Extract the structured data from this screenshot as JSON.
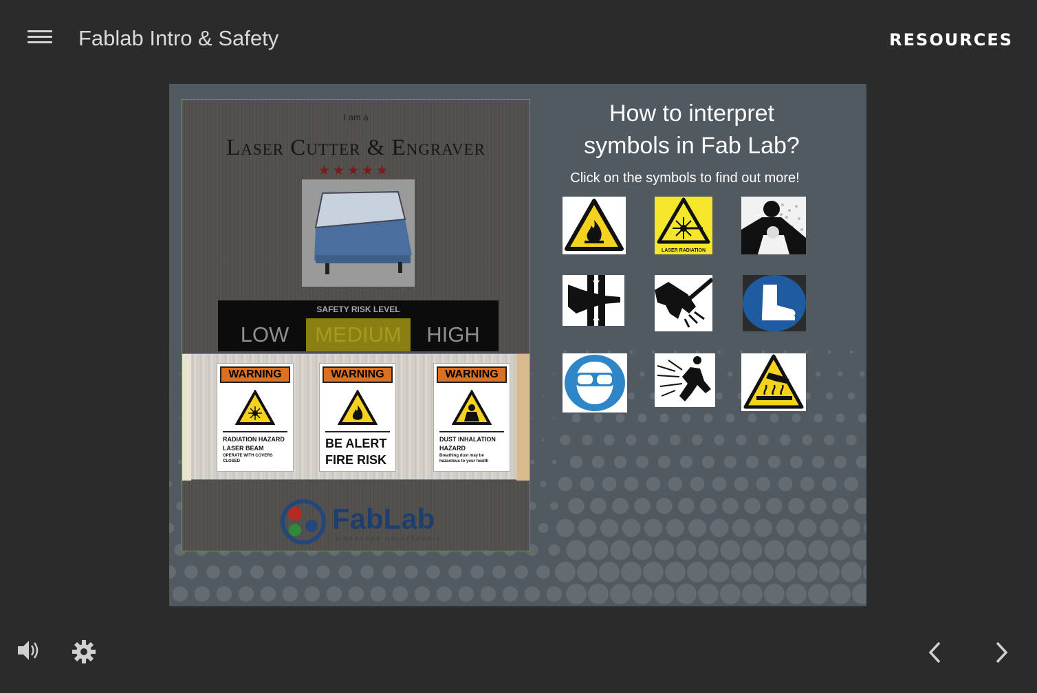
{
  "header": {
    "menu_icon": "hamburger-menu-icon",
    "course_title": "Fablab Intro & Safety",
    "resources_label": "RESOURCES"
  },
  "poster": {
    "intro": "I am a",
    "heading": "Laser Cutter & Engraver",
    "stars": "★★★★★",
    "risk_title": "SAFETY RISK LEVEL",
    "risk_levels": [
      "LOW",
      "MEDIUM",
      "HIGH"
    ],
    "selected_risk": "MEDIUM",
    "warnings": [
      {
        "header": "WARNING",
        "line1": "RADIATION HAZARD",
        "line2": "LASER BEAM",
        "note": "OPERATE WITH COVERS CLOSED"
      },
      {
        "header": "WARNING",
        "line1": "BE ALERT",
        "line2": "FIRE RISK",
        "note": ""
      },
      {
        "header": "WARNING",
        "line1": "DUST INHALATION",
        "line2": "HAZARD",
        "note": "Breathing dust may be hazardous to your health"
      }
    ],
    "logo_word": "FabLab",
    "logo_sub": "SINGAPORE POLYTECHNIC"
  },
  "panel": {
    "title_line1": "How to interpret",
    "title_line2": "symbols in Fab Lab?",
    "subtitle": "Click on the symbols to find out more!",
    "symbols": [
      "flammable-warning-icon",
      "laser-radiation-warning-icon",
      "dust-inhalation-icon",
      "crush-hazard-icon",
      "hand-cut-hazard-icon",
      "safety-boots-icon",
      "eye-protection-icon",
      "electric-shock-icon",
      "hot-surface-warning-icon"
    ],
    "laser_label": "LASER RADIATION"
  },
  "footer": {
    "volume_icon": "volume-icon",
    "settings_icon": "gear-icon",
    "prev_icon": "chevron-left-icon",
    "next_icon": "chevron-right-icon"
  },
  "colors": {
    "background": "#2b2b2b",
    "slide": "#515a60",
    "warning_orange": "#d97022",
    "medium_highlight": "#8a7f12",
    "safety_blue": "#2f86c6",
    "warning_yellow": "#f4d21e"
  }
}
